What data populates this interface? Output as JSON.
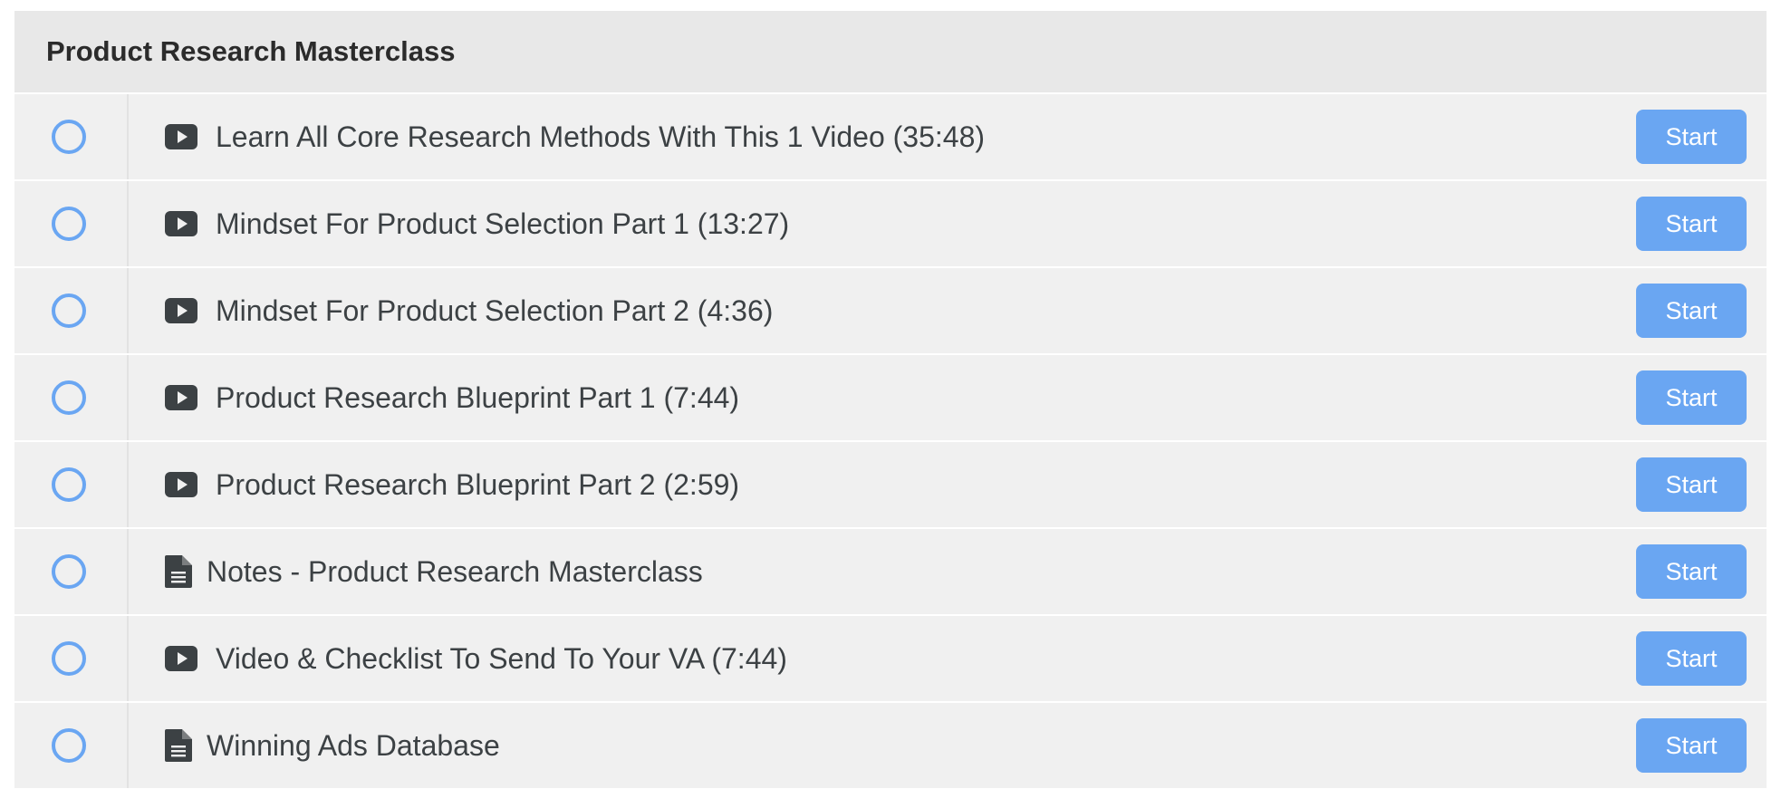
{
  "section": {
    "title": "Product Research Masterclass"
  },
  "colors": {
    "accent": "#6aa6f2",
    "header_bg": "#e8e8e8",
    "row_bg": "#f0f0f0",
    "icon": "#3c4144"
  },
  "lectures": [
    {
      "icon": "play-icon",
      "title": "Learn All Core Research Methods With This 1 Video (35:48)",
      "button": "Start"
    },
    {
      "icon": "play-icon",
      "title": "Mindset For Product Selection Part 1 (13:27)",
      "button": "Start"
    },
    {
      "icon": "play-icon",
      "title": "Mindset For Product Selection Part 2 (4:36)",
      "button": "Start"
    },
    {
      "icon": "play-icon",
      "title": "Product Research Blueprint Part 1 (7:44)",
      "button": "Start"
    },
    {
      "icon": "play-icon",
      "title": "Product Research Blueprint Part 2 (2:59)",
      "button": "Start"
    },
    {
      "icon": "file-icon",
      "title": "Notes - Product Research Masterclass",
      "button": "Start"
    },
    {
      "icon": "play-icon",
      "title": "Video & Checklist To Send To Your VA (7:44)",
      "button": "Start"
    },
    {
      "icon": "file-icon",
      "title": "Winning Ads Database",
      "button": "Start"
    }
  ]
}
